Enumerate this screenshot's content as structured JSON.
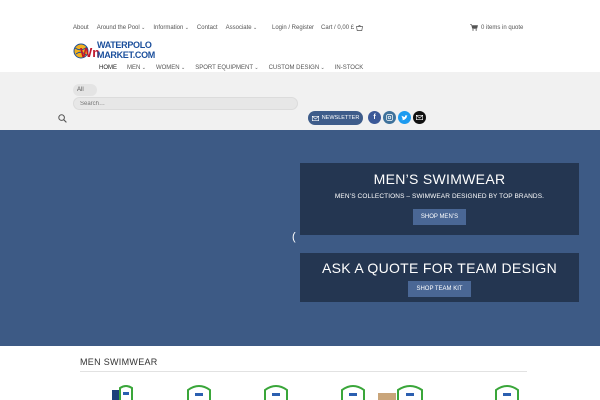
{
  "topnav": {
    "items": [
      {
        "label": "About",
        "dropdown": false
      },
      {
        "label": "Around the Pool",
        "dropdown": true
      },
      {
        "label": "Information",
        "dropdown": true
      },
      {
        "label": "Contact",
        "dropdown": false
      },
      {
        "label": "Associate",
        "dropdown": true
      }
    ],
    "login": "Login / Register",
    "cart": "Cart / 0,00 £",
    "quote": "0 items in quote"
  },
  "logo": {
    "line1": "WATERPOLO",
    "line2": "MARKET.COM",
    "mark": "Wm"
  },
  "mainnav": {
    "items": [
      {
        "label": "HOME",
        "dropdown": false
      },
      {
        "label": "MEN",
        "dropdown": true
      },
      {
        "label": "WOMEN",
        "dropdown": true
      },
      {
        "label": "SPORT EQUIPMENT",
        "dropdown": true
      },
      {
        "label": "CUSTOM DESIGN",
        "dropdown": true
      },
      {
        "label": "IN-STOCK",
        "dropdown": false
      }
    ]
  },
  "search": {
    "category": "All",
    "placeholder": "Search…"
  },
  "newsletter": {
    "label": "NEWSLETTER"
  },
  "social": [
    "facebook-icon",
    "instagram-icon",
    "twitter-icon",
    "email-icon"
  ],
  "hero": {
    "card1": {
      "title": "MEN’S SWIMWEAR",
      "subtitle": "MEN’S COLLECTIONS – SWIMWEAR DESIGNED BY TOP BRANDS.",
      "button": "SHOP MEN’S"
    },
    "card2": {
      "title": "ASK A QUOTE FOR TEAM DESIGN",
      "button": "SHOP TEAM KIT"
    }
  },
  "section": {
    "title": "MEN SWIMWEAR"
  },
  "colors": {
    "hero_bg": "#3d5a85",
    "card_bg": "#243651",
    "button_bg": "#4a6795",
    "band_bg": "#f1f1f1",
    "brand_blue": "#1b4f9c",
    "badge_green": "#3aa63a"
  }
}
